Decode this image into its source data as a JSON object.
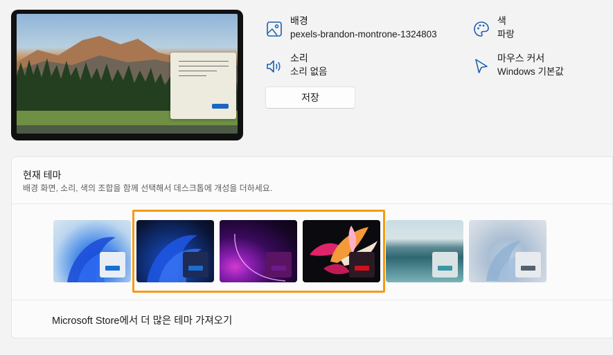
{
  "background": {
    "title": "배경",
    "value": "pexels-brandon-montrone-1324803",
    "icon": "image-icon"
  },
  "color": {
    "title": "색",
    "value": "파랑",
    "icon": "palette-icon"
  },
  "sound": {
    "title": "소리",
    "value": "소리 없음",
    "icon": "speaker-icon"
  },
  "cursor": {
    "title": "마우스 커서",
    "value": "Windows 기본값",
    "icon": "pointer-icon"
  },
  "save_label": "저장",
  "current_theme": {
    "title": "현재 테마",
    "description": "배경 화면, 소리, 색의 조합을 함께 선택해서 데스크톱에 개성을 더하세요.",
    "themes": [
      {
        "name": "windows-light",
        "accent": "#1a6fd1",
        "chip": "#e9eef6"
      },
      {
        "name": "windows-dark",
        "accent": "#1a6fd1",
        "chip": "#1d2b56"
      },
      {
        "name": "glow",
        "accent": "#6b1c8a",
        "chip": "#5b1464"
      },
      {
        "name": "captured-motion",
        "accent": "#d1101b",
        "chip": "#2a1a24"
      },
      {
        "name": "sunrise",
        "accent": "#3e95a6",
        "chip": "#d9e3e4"
      },
      {
        "name": "flow",
        "accent": "#56616c",
        "chip": "#e7eaee"
      }
    ],
    "store_link": "Microsoft Store에서 더 많은 테마 가져오기"
  },
  "colors": {
    "selection": "#f59b10",
    "accent": "#1a66c2"
  }
}
